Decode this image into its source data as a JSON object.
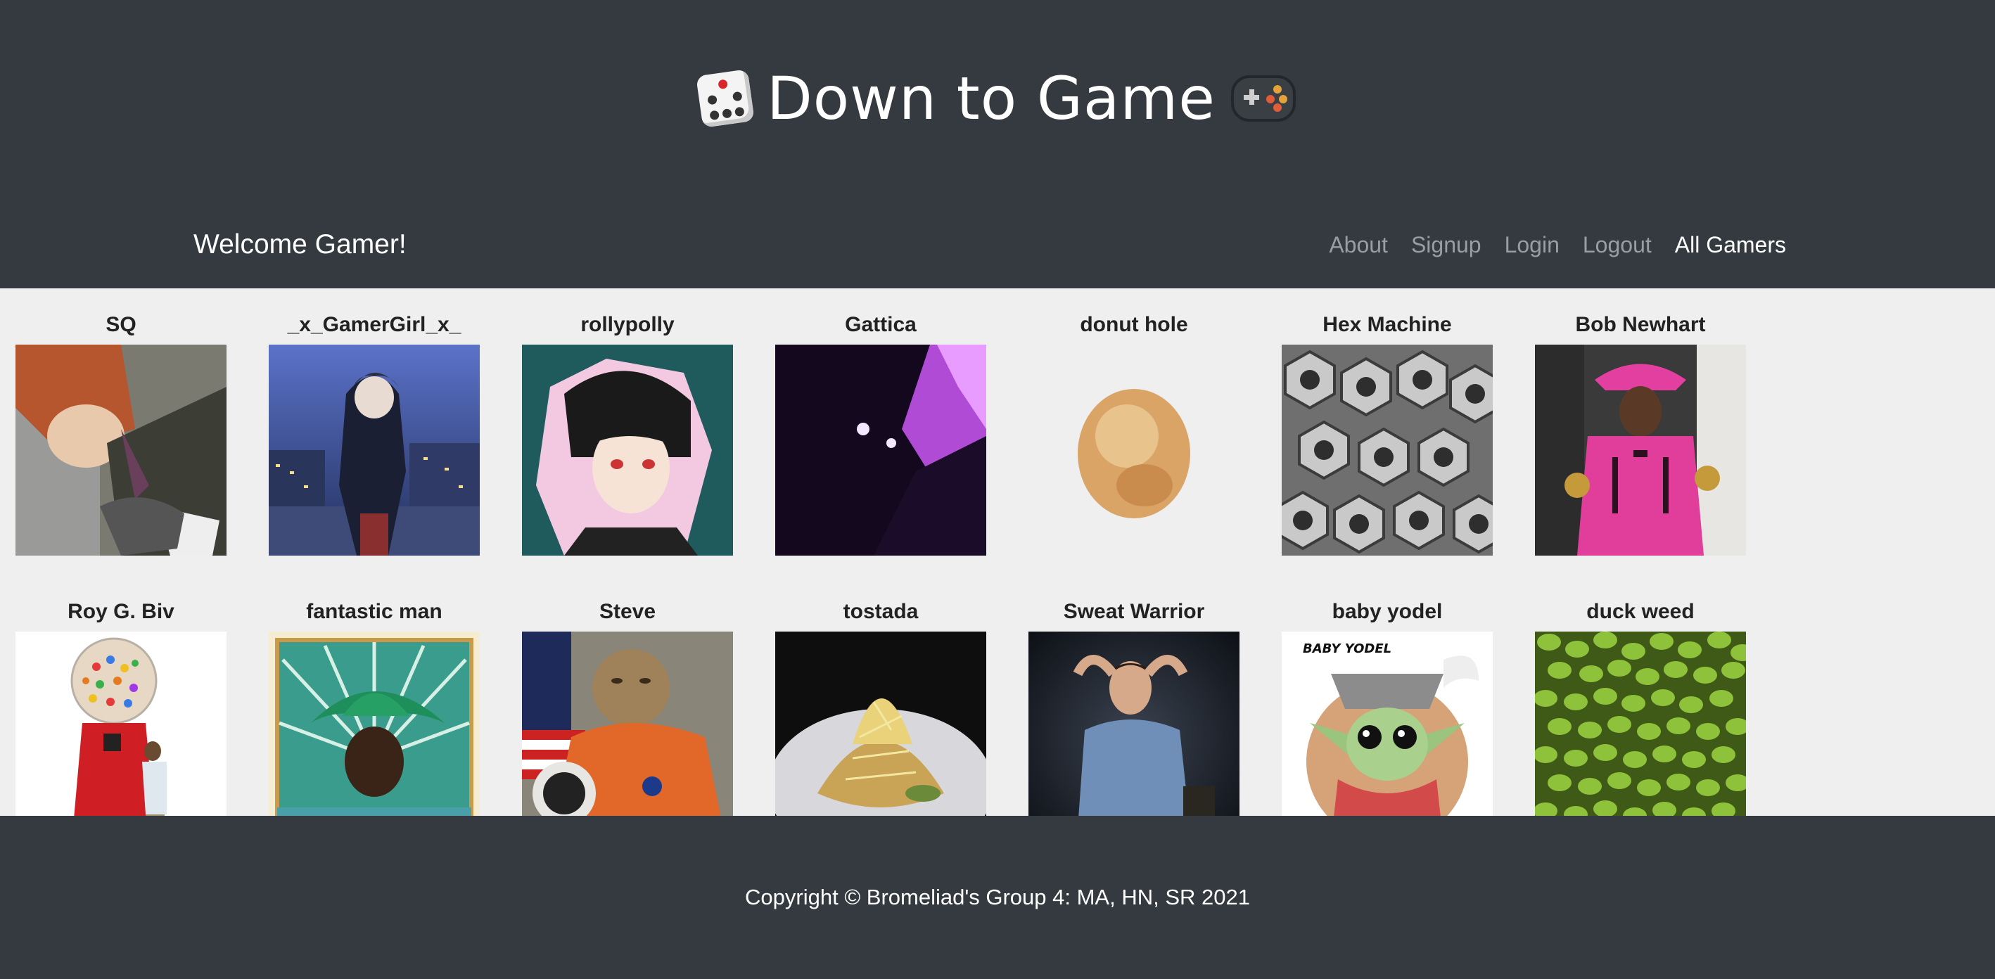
{
  "header": {
    "title": "Down to Game",
    "left_icon": "die-icon",
    "right_icon": "gamepad-icon",
    "welcome": "Welcome Gamer!"
  },
  "nav": {
    "items": [
      {
        "label": "About",
        "active": false
      },
      {
        "label": "Signup",
        "active": false
      },
      {
        "label": "Login",
        "active": false
      },
      {
        "label": "Logout",
        "active": false
      },
      {
        "label": "All Gamers",
        "active": true
      }
    ]
  },
  "gamers": [
    {
      "name": "SQ",
      "avatar": "anime-boy-avatar"
    },
    {
      "name": "_x_GamerGirl_x_",
      "avatar": "anime-city-avatar"
    },
    {
      "name": "rollypolly",
      "avatar": "anime-portrait-avatar"
    },
    {
      "name": "Gattica",
      "avatar": "purple-silhouette-avatar"
    },
    {
      "name": "donut hole",
      "avatar": "donut-hole-avatar"
    },
    {
      "name": "Hex Machine",
      "avatar": "hex-nuts-avatar"
    },
    {
      "name": "Bob Newhart",
      "avatar": "pink-cowboy-avatar"
    },
    {
      "name": "Roy G. Biv",
      "avatar": "gumball-machine-avatar"
    },
    {
      "name": "fantastic man",
      "avatar": "green-hat-poster-avatar"
    },
    {
      "name": "Steve",
      "avatar": "astronaut-cat-avatar"
    },
    {
      "name": "tostada",
      "avatar": "tostada-avatar"
    },
    {
      "name": "Sweat Warrior",
      "avatar": "man-in-chair-avatar"
    },
    {
      "name": "baby yodel",
      "avatar": "baby-yodel-avatar",
      "caption": "BABY YODEL"
    },
    {
      "name": "duck weed",
      "avatar": "duck-weed-avatar"
    }
  ],
  "footer": {
    "copyright": "Copyright © Bromeliad's Group 4: MA, HN, SR 2021"
  }
}
